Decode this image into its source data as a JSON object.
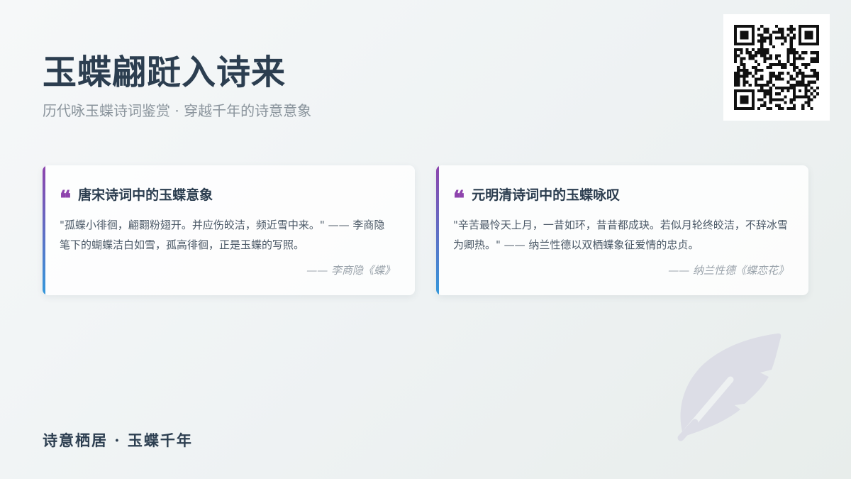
{
  "header": {
    "title": "玉蝶翩跹入诗来",
    "subtitle": "历代咏玉蝶诗词鉴赏 · 穿越千年的诗意意象"
  },
  "qr_code": {
    "icon": "qr-code-icon"
  },
  "cards": [
    {
      "icon": "quote-icon",
      "quote_mark": "❝",
      "title": "唐宋诗词中的玉蝶意象",
      "body": "\"孤蝶小徘徊，翩翾粉翅开。并应伤皎洁，频近雪中来。\" —— 李商隐笔下的蝴蝶洁白如雪，孤高徘徊，正是玉蝶的写照。",
      "source": "—— 李商隐《蝶》"
    },
    {
      "icon": "quote-icon",
      "quote_mark": "❝",
      "title": "元明清诗词中的玉蝶咏叹",
      "body": "\"辛苦最怜天上月，一昔如环，昔昔都成玦。若似月轮终皎洁，不辞冰雪为卿热。\" —— 纳兰性德以双栖蝶象征爱情的忠贞。",
      "source": "—— 纳兰性德《蝶恋花》"
    }
  ],
  "decoration": {
    "icon": "feather-icon"
  },
  "footer": {
    "text": "诗意栖居 · 玉蝶千年"
  },
  "colors": {
    "accent_purple": "#8e44ad",
    "accent_blue": "#3498db",
    "title_text": "#2c3e50",
    "feather": "#dcdde6"
  }
}
